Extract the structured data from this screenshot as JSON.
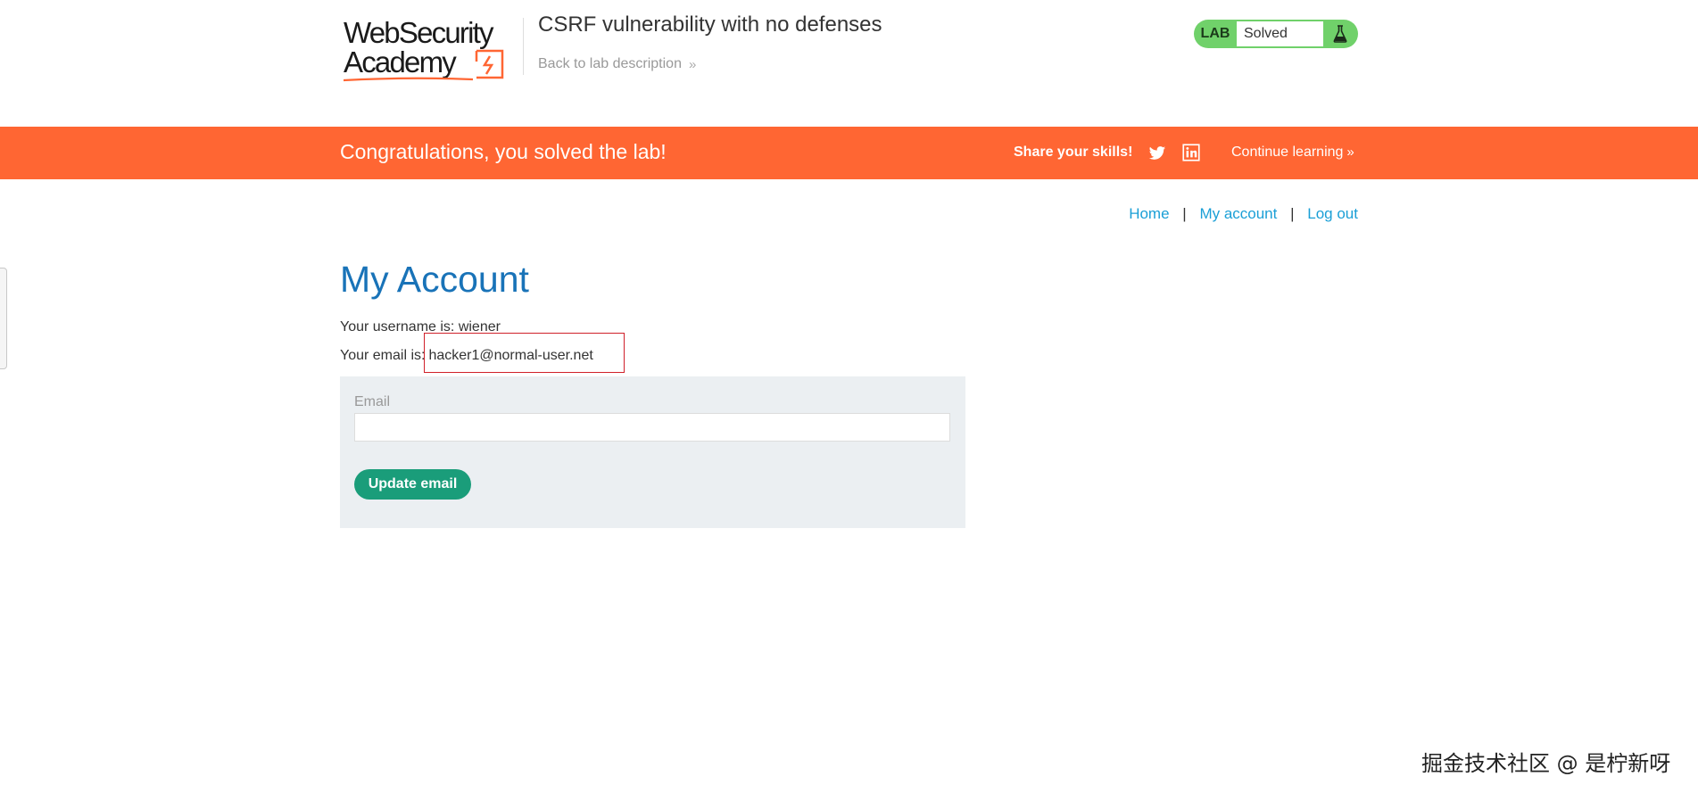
{
  "header": {
    "logo_line1": "WebSecurity",
    "logo_line2": "Academy",
    "lab_title": "CSRF vulnerability with no defenses",
    "back_link": "Back to lab description",
    "lab_status": {
      "label": "LAB",
      "value": "Solved",
      "icon": "flask-icon",
      "color": "#70d16a"
    }
  },
  "banner": {
    "message": "Congratulations, you solved the lab!",
    "share_label": "Share your skills!",
    "twitter_icon": "twitter-icon",
    "linkedin_icon": "linkedin-icon",
    "continue_label": "Continue learning",
    "color": "#ff6633"
  },
  "nav": {
    "home": "Home",
    "my_account": "My account",
    "log_out": "Log out",
    "separator": "|"
  },
  "main": {
    "title": "My Account",
    "username_text": "Your username is: wiener",
    "email_label": "Your email is:",
    "email_value": "hacker1@normal-user.net",
    "form": {
      "email_label": "Email",
      "email_value": "",
      "button_label": "Update email"
    }
  },
  "watermark": "掘金技术社区 @ 是柠新呀",
  "colors": {
    "title_blue": "#1973b8",
    "link_blue": "#1a9fd6",
    "button_green": "#1a9d7a",
    "highlight_red": "#d0202a"
  }
}
